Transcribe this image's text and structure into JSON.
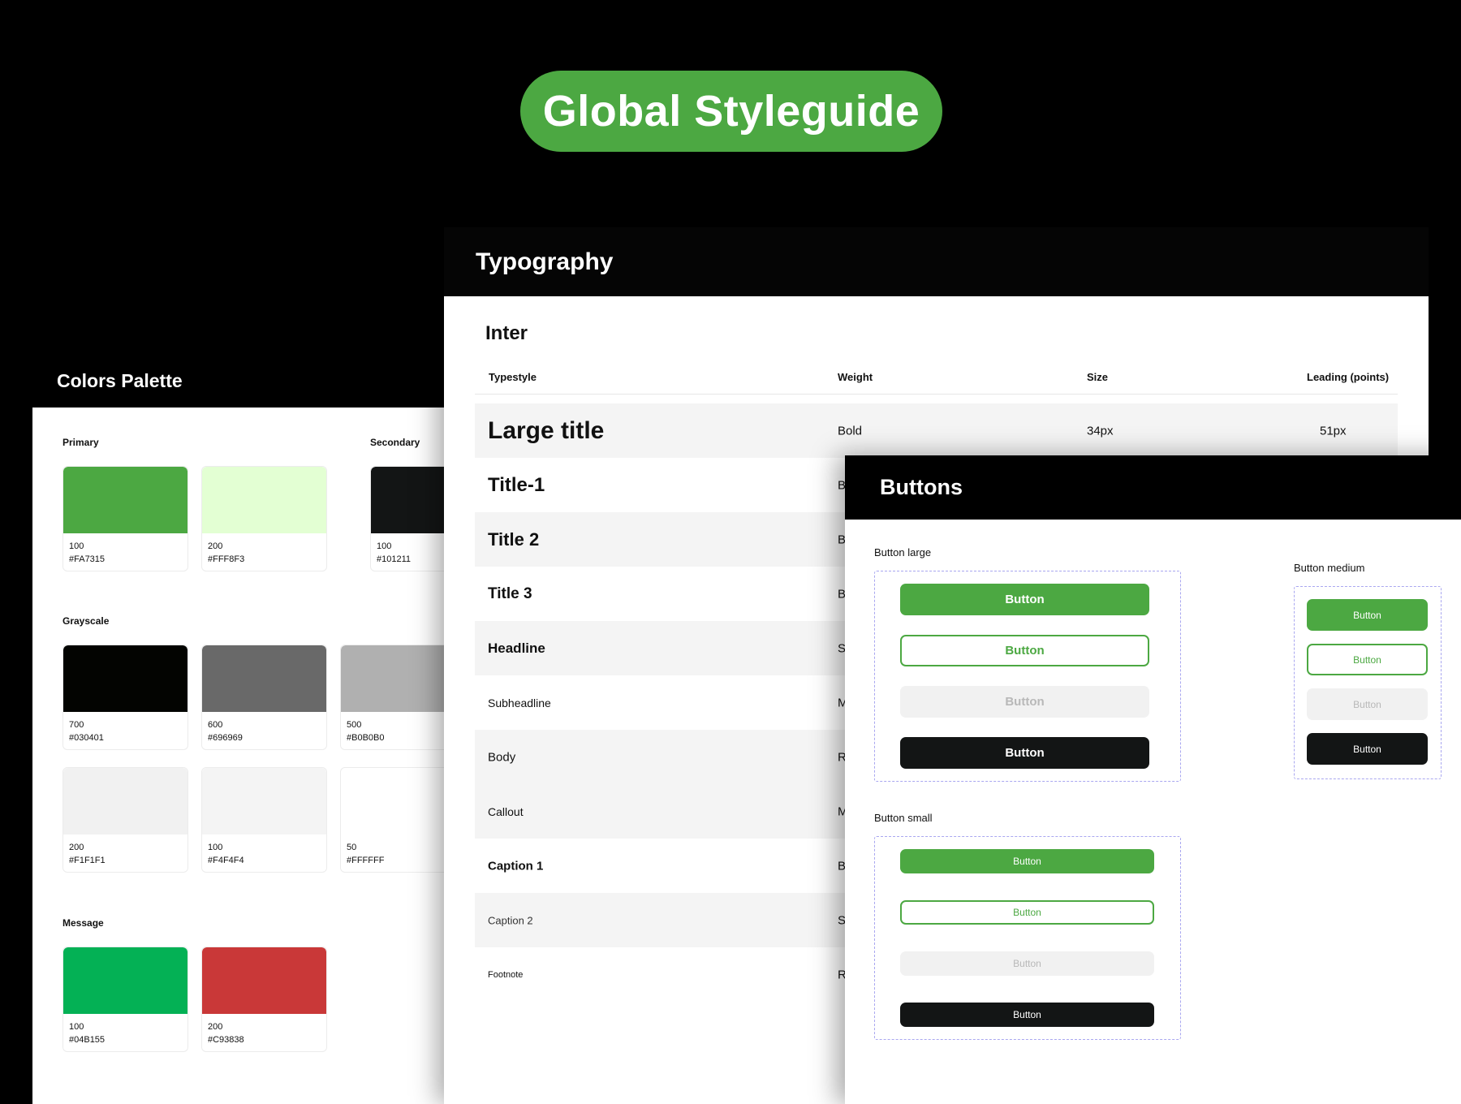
{
  "header": {
    "title": "Global Styleguide"
  },
  "colors": {
    "title": "Colors Palette",
    "primary_label": "Primary",
    "secondary_label": "Secondary",
    "grayscale_label": "Grayscale",
    "message_label": "Message",
    "swatches": [
      {
        "num": "100",
        "hex": "#FA7315",
        "color": "#4CA842"
      },
      {
        "num": "200",
        "hex": "#FFF8F3",
        "color": "#E3FFD3"
      },
      {
        "num": "100",
        "hex": "#101211",
        "color": "#131515"
      },
      {
        "num": "700",
        "hex": "#030401",
        "color": "#030401"
      },
      {
        "num": "600",
        "hex": "#696969",
        "color": "#696969"
      },
      {
        "num": "500",
        "hex": "#B0B0B0",
        "color": "#B0B0B0"
      },
      {
        "num": "200",
        "hex": "#F1F1F1",
        "color": "#F1F1F1"
      },
      {
        "num": "100",
        "hex": "#F4F4F4",
        "color": "#F4F4F4"
      },
      {
        "num": "50",
        "hex": "#FFFFFF",
        "color": "#FFFFFF"
      },
      {
        "num": "100",
        "hex": "#04B155",
        "color": "#04B155"
      },
      {
        "num": "200",
        "hex": "#C93838",
        "color": "#C93838"
      }
    ]
  },
  "typography": {
    "title": "Typography",
    "font": "Inter",
    "headers": {
      "typestyle": "Typestyle",
      "weight": "Weight",
      "size": "Size",
      "leading": "Leading (points)"
    },
    "rows": [
      {
        "name": "Large title",
        "weight": "Bold",
        "size": "34px",
        "leading": "51px"
      },
      {
        "name": "Title-1",
        "weight": "B"
      },
      {
        "name": "Title 2",
        "weight": "B"
      },
      {
        "name": "Title 3",
        "weight": "B"
      },
      {
        "name": "Headline",
        "weight": "S"
      },
      {
        "name": "Subheadline",
        "weight": "M"
      },
      {
        "name": "Body",
        "weight": "R"
      },
      {
        "name": "Callout",
        "weight": "M"
      },
      {
        "name": "Caption 1",
        "weight": "B"
      },
      {
        "name": "Caption 2",
        "weight": "S"
      },
      {
        "name": "Footnote",
        "weight": "R"
      }
    ]
  },
  "buttons": {
    "title": "Buttons",
    "large_label": "Button large",
    "medium_label": "Button medium",
    "small_label": "Button small",
    "button_text": "Button"
  }
}
